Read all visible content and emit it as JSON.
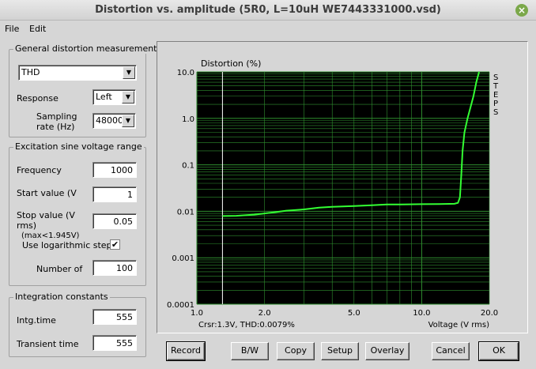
{
  "window": {
    "title": "Distortion vs. amplitude (5R0, L=10uH WE7443331000.vsd)",
    "close_glyph": "×"
  },
  "menu": {
    "file": "File",
    "edit": "Edit"
  },
  "general": {
    "title": "General distortion measurement",
    "measurement_value": "THD",
    "response_label": "Response",
    "response_value": "Left",
    "sampling_label_1": "Sampling",
    "sampling_label_2": "rate (Hz)",
    "sampling_value": "48000"
  },
  "excitation": {
    "title": "Excitation sine voltage range",
    "frequency_label": "Frequency",
    "frequency_value": "1000",
    "start_label": "Start value (V",
    "start_value": "1",
    "stop_label_1": "Stop value (V",
    "stop_label_2": "rms)",
    "stop_label_3": "(max<1.945V)",
    "stop_value": "0.05",
    "log_steps_label": "Use logarithmic steps",
    "log_steps_checked": "✔",
    "steps_label": "Number of",
    "steps_value": "100"
  },
  "integration": {
    "title": "Integration constants",
    "intg_label": "Intg.time",
    "intg_value": "555",
    "transient_label": "Transient time",
    "transient_value": "555"
  },
  "buttons": {
    "record": "Record",
    "bw": "B/W",
    "copy": "Copy",
    "setup": "Setup",
    "overlay": "Overlay",
    "cancel": "Cancel",
    "ok": "OK"
  },
  "chart_data": {
    "type": "line",
    "title": "Distortion (%)",
    "xlabel": "Voltage (V rms)",
    "side_label": "STEPS",
    "cursor_readout": "Crsr:1.3V, THD:0.0079%",
    "x_scale": "log",
    "y_scale": "log",
    "xlim": [
      1.0,
      20.0
    ],
    "ylim": [
      0.0001,
      10.0
    ],
    "x_ticks": [
      1.0,
      2.0,
      5.0,
      10.0,
      20.0
    ],
    "x_tick_labels": [
      "1.0",
      "2.0",
      "5.0",
      "10.0",
      "20.0"
    ],
    "y_ticks": [
      0.0001,
      0.001,
      0.01,
      0.1,
      1.0,
      10.0
    ],
    "y_tick_labels": [
      "0.0001",
      "0.001",
      "0.01",
      "0.1",
      "1.0",
      "10.0"
    ],
    "cursor_x": 1.3,
    "colors": {
      "background": "#000000",
      "grid": "#2f8f2f",
      "line": "#33ff33",
      "cursor": "#ffffff"
    },
    "series": [
      {
        "x": [
          1.3,
          1.5,
          1.8,
          2.0,
          2.2,
          2.5,
          3.0,
          3.5,
          4.0,
          5.0,
          6.0,
          7.0,
          8.0,
          10.0,
          12.0,
          14.0,
          14.5,
          14.8,
          15.0,
          15.2,
          15.5,
          16.0,
          17.0,
          17.5,
          18.0
        ],
        "y": [
          0.0079,
          0.008,
          0.0085,
          0.009,
          0.0095,
          0.0103,
          0.011,
          0.012,
          0.0125,
          0.013,
          0.0135,
          0.014,
          0.014,
          0.0142,
          0.0143,
          0.0145,
          0.0152,
          0.02,
          0.06,
          0.2,
          0.5,
          1.0,
          3.0,
          6.0,
          10.0
        ]
      }
    ]
  }
}
